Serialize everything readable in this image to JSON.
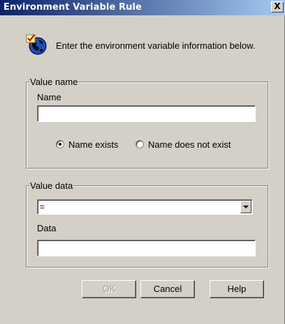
{
  "window": {
    "title": "Environment Variable Rule",
    "close_label": "X"
  },
  "intro_text": "Enter the environment variable information below.",
  "value_name_group": {
    "label": "Value name",
    "name_label": "Name",
    "name_value": "",
    "radio_exists_label": "Name exists",
    "radio_not_exist_label": "Name does not exist",
    "selected_option": "Name exists"
  },
  "value_data_group": {
    "label": "Value data",
    "operator_value": "=",
    "data_label": "Data",
    "data_value": ""
  },
  "buttons": {
    "ok": "OK",
    "cancel": "Cancel",
    "help": "Help"
  }
}
